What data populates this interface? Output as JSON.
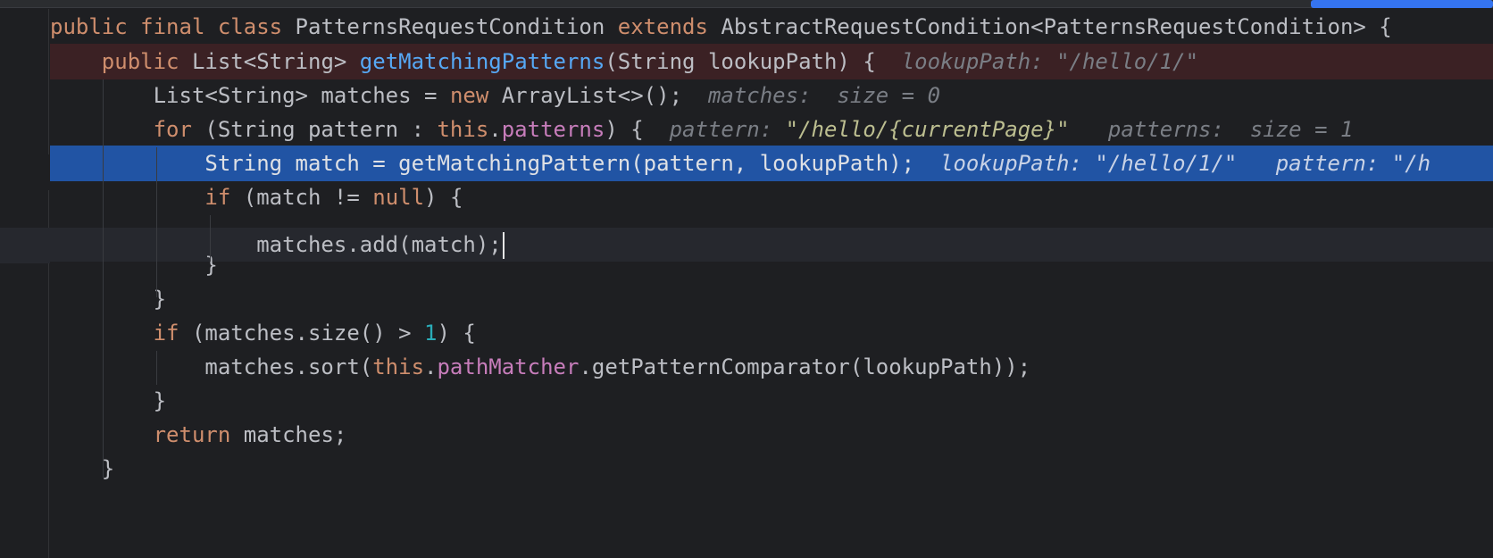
{
  "editor": {
    "lines": {
      "l1": {
        "kw1": "public final class ",
        "t1": "PatternsRequestCondition ",
        "kw2": "extends ",
        "t2": "AbstractRequestCondition<PatternsRequestCondition> {"
      },
      "l2": {
        "kw1": "public ",
        "t1": "List<String> ",
        "fn1": "getMatchingPatterns",
        "t2": "(String lookupPath) {",
        "h1": "lookupPath: ",
        "s1": "\"/hello/1/\""
      },
      "l3": {
        "t1": "List<String> matches = ",
        "kw1": "new ",
        "t2": "ArrayList<>();",
        "h1": "matches:  size = 0"
      },
      "l4": {
        "kw1": "for ",
        "t1": "(String pattern : ",
        "kw2": "this",
        "t2": ".",
        "f1": "patterns",
        "t3": ") {",
        "h1": "pattern: ",
        "s1": "\"/hello/{currentPage}\"",
        "h2": "patterns:  size = 1"
      },
      "l5": {
        "t1": "String match = getMatchingPattern(pattern, lookupPath);",
        "h1": "lookupPath: ",
        "s1": "\"/hello/1/\"",
        "h2": "pattern: ",
        "s2": "\"/h"
      },
      "l6": {
        "kw1": "if ",
        "t1": "(match != ",
        "kw2": "null",
        "t2": ") {"
      },
      "l7": {
        "t1": "matches.add(match);"
      },
      "l8": {
        "t1": "}"
      },
      "l9": {
        "t1": "}"
      },
      "l10": {
        "kw1": "if ",
        "t1": "(matches.size() > ",
        "n1": "1",
        "t2": ") {"
      },
      "l11": {
        "t1": "matches.sort(",
        "kw1": "this",
        "t2": ".",
        "f1": "pathMatcher",
        "t3": ".getPatternComparator(lookupPath));"
      },
      "l12": {
        "t1": "}"
      },
      "l13": {
        "kw1": "return ",
        "t1": "matches;"
      },
      "l14": {
        "t1": "}"
      }
    }
  }
}
